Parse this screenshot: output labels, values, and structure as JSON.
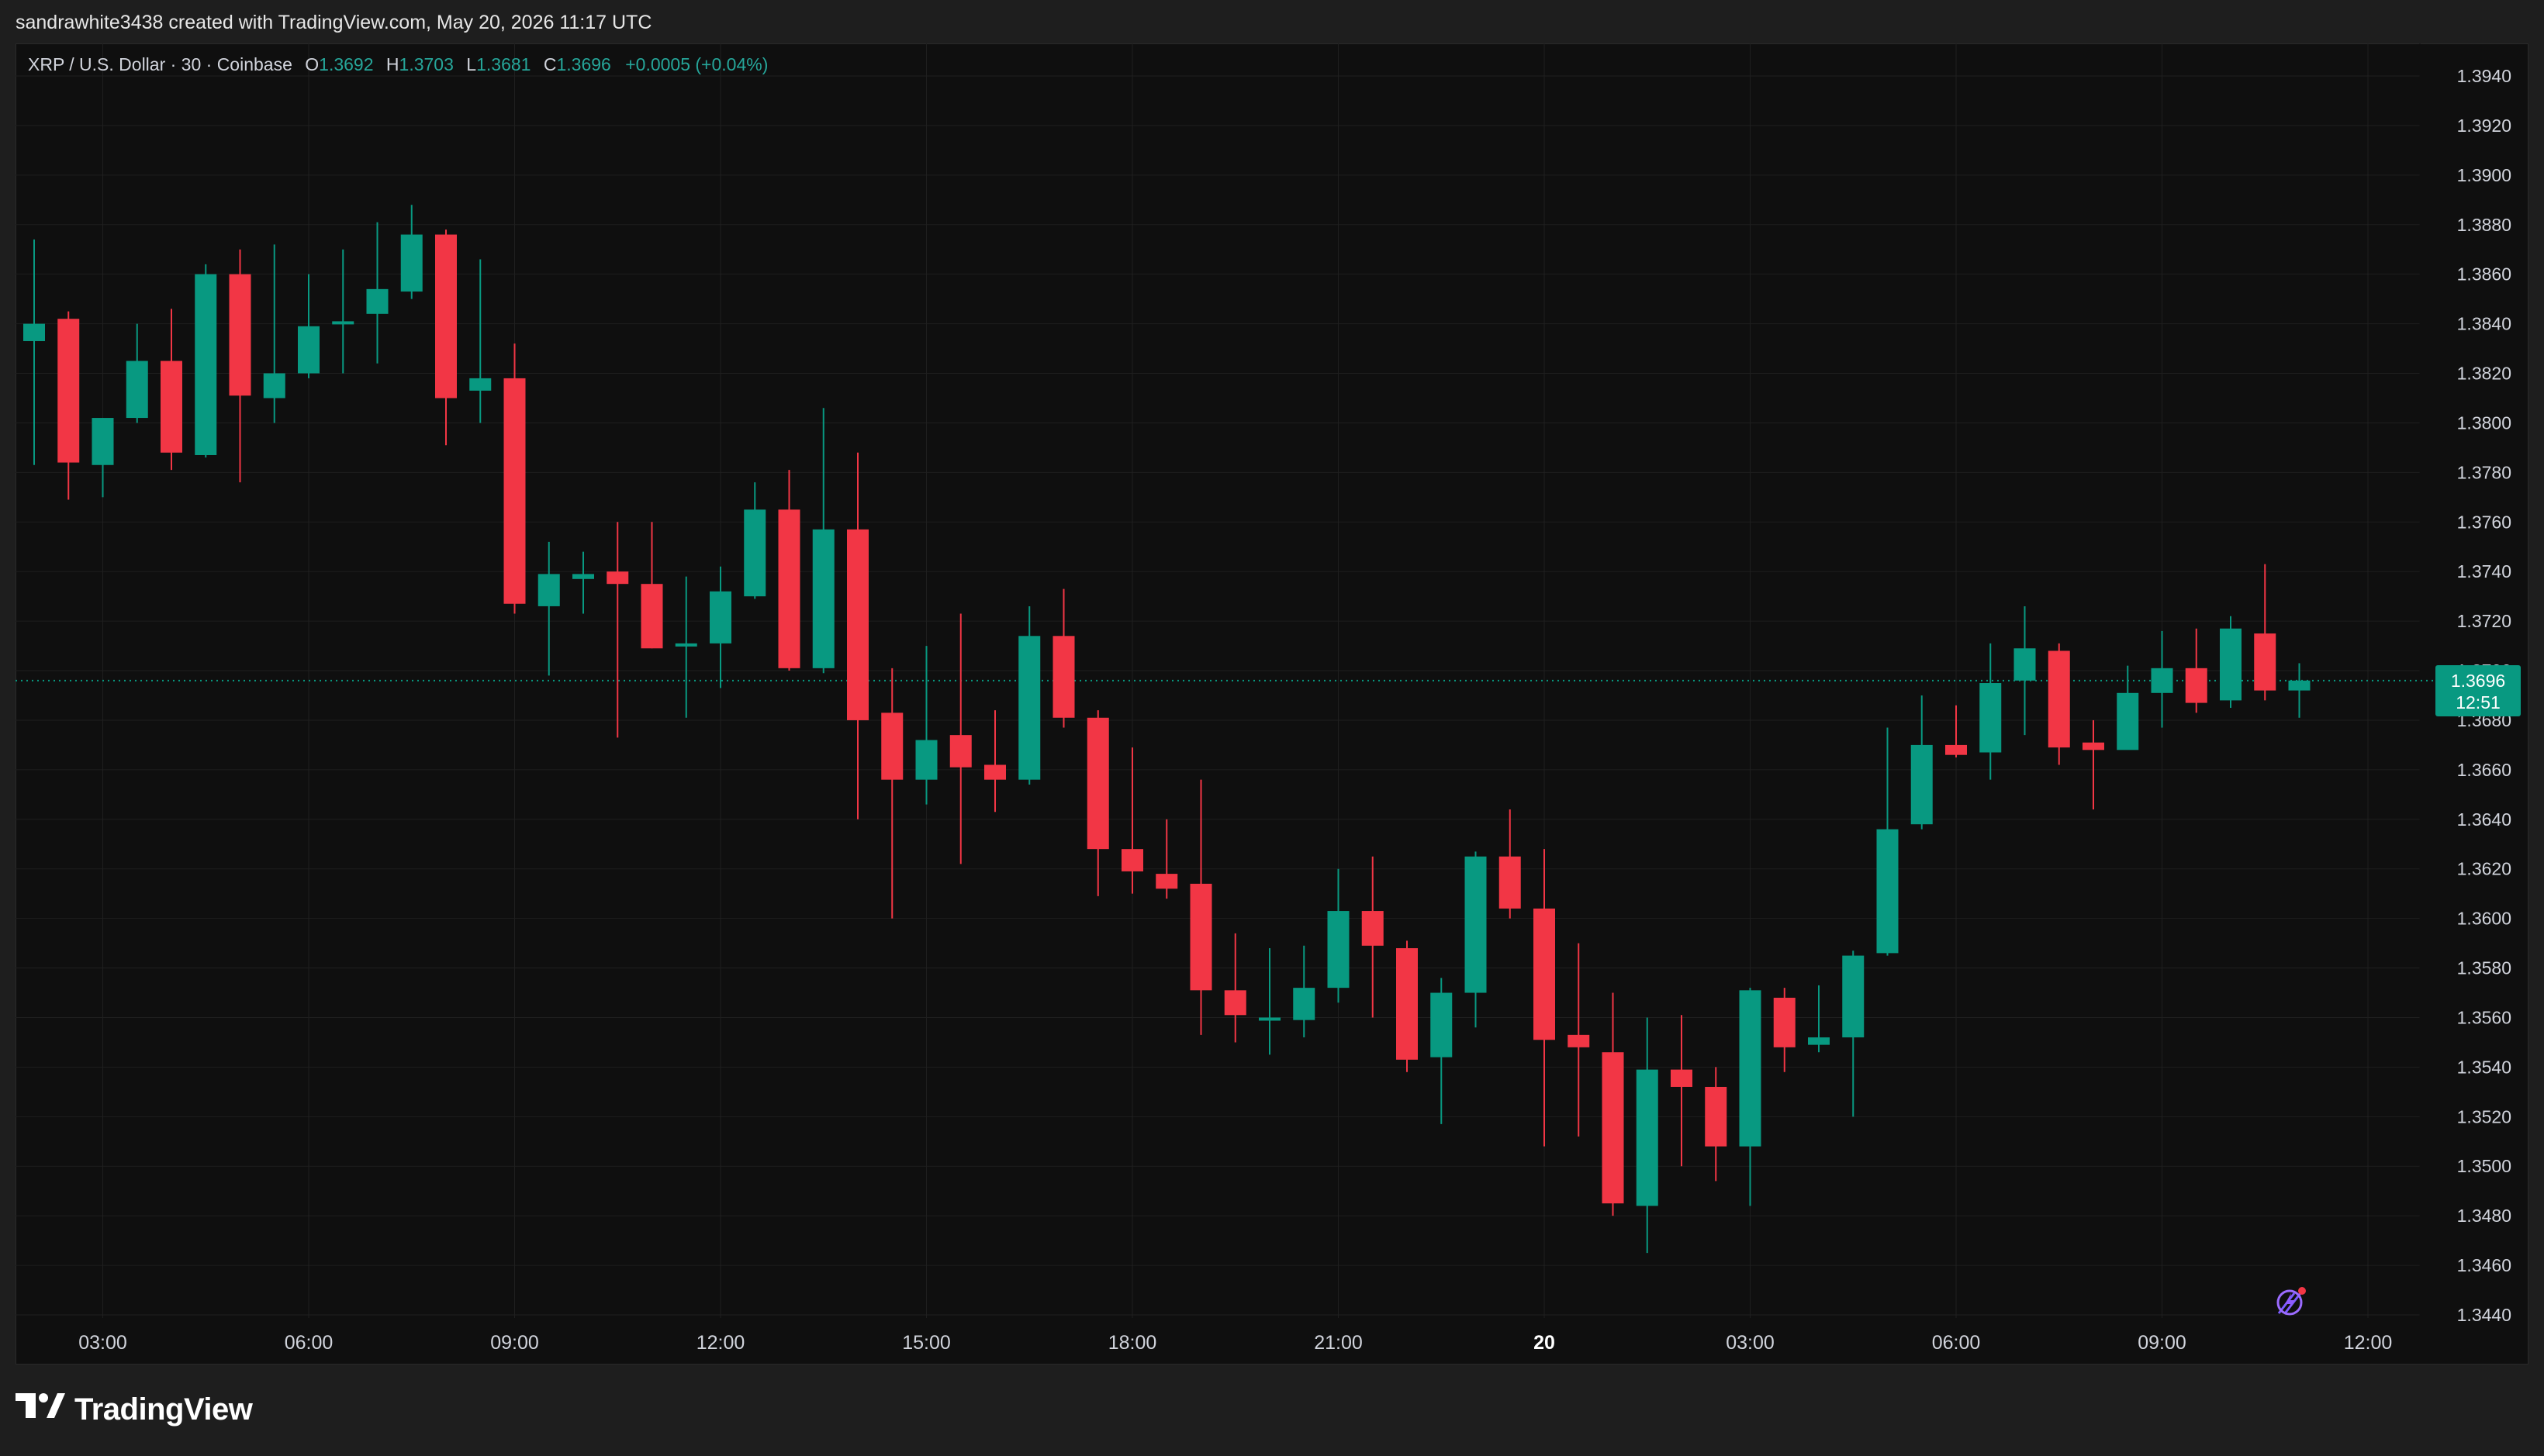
{
  "header": {
    "attribution": "sandrawhite3438 created with TradingView.com, May 20, 2026 11:17 UTC"
  },
  "legend": {
    "symbol": "XRP / U.S. Dollar · 30 · Coinbase",
    "o_label": "O",
    "o_value": "1.3692",
    "h_label": "H",
    "h_value": "1.3703",
    "l_label": "L",
    "l_value": "1.3681",
    "c_label": "C",
    "c_value": "1.3696",
    "change": "+0.0005 (+0.04%)"
  },
  "price_tag": {
    "price": "1.3696",
    "countdown": "12:51"
  },
  "footer": {
    "brand": "TradingView"
  },
  "colors": {
    "up": "#089981",
    "down": "#f23645",
    "background": "#0f0f0f",
    "grid": "#1f1f1f",
    "text": "#d1d4dc"
  },
  "chart_data": {
    "type": "candlestick",
    "ylim": [
      1.344,
      1.394
    ],
    "y_ticks": [
      "1.3940",
      "1.3920",
      "1.3900",
      "1.3880",
      "1.3860",
      "1.3840",
      "1.3820",
      "1.3800",
      "1.3780",
      "1.3760",
      "1.3740",
      "1.3720",
      "1.3700",
      "1.3680",
      "1.3660",
      "1.3640",
      "1.3620",
      "1.3600",
      "1.3580",
      "1.3560",
      "1.3540",
      "1.3520",
      "1.3500",
      "1.3480",
      "1.3460",
      "1.3440"
    ],
    "x_ticks": [
      {
        "label": "03:00",
        "bar": 2,
        "bold": false
      },
      {
        "label": "06:00",
        "bar": 8,
        "bold": false
      },
      {
        "label": "09:00",
        "bar": 14,
        "bold": false
      },
      {
        "label": "12:00",
        "bar": 20,
        "bold": false
      },
      {
        "label": "15:00",
        "bar": 26,
        "bold": false
      },
      {
        "label": "18:00",
        "bar": 32,
        "bold": false
      },
      {
        "label": "21:00",
        "bar": 38,
        "bold": false
      },
      {
        "label": "20",
        "bar": 44,
        "bold": true
      },
      {
        "label": "03:00",
        "bar": 50,
        "bold": false
      },
      {
        "label": "06:00",
        "bar": 56,
        "bold": false
      },
      {
        "label": "09:00",
        "bar": 62,
        "bold": false
      },
      {
        "label": "12:00",
        "bar": 68,
        "bold": false
      }
    ],
    "last_price": 1.3696,
    "candles": [
      {
        "o": 1.3833,
        "h": 1.3874,
        "l": 1.3783,
        "c": 1.384
      },
      {
        "o": 1.3842,
        "h": 1.3845,
        "l": 1.3769,
        "c": 1.3784
      },
      {
        "o": 1.3783,
        "h": 1.3802,
        "l": 1.377,
        "c": 1.3802
      },
      {
        "o": 1.3802,
        "h": 1.384,
        "l": 1.38,
        "c": 1.3825
      },
      {
        "o": 1.3825,
        "h": 1.3846,
        "l": 1.3781,
        "c": 1.3788
      },
      {
        "o": 1.3787,
        "h": 1.3864,
        "l": 1.3786,
        "c": 1.386
      },
      {
        "o": 1.386,
        "h": 1.387,
        "l": 1.3776,
        "c": 1.3811
      },
      {
        "o": 1.381,
        "h": 1.3872,
        "l": 1.38,
        "c": 1.382
      },
      {
        "o": 1.382,
        "h": 1.386,
        "l": 1.3818,
        "c": 1.3839
      },
      {
        "o": 1.384,
        "h": 1.387,
        "l": 1.382,
        "c": 1.3841
      },
      {
        "o": 1.3844,
        "h": 1.3881,
        "l": 1.3824,
        "c": 1.3854
      },
      {
        "o": 1.3853,
        "h": 1.3888,
        "l": 1.385,
        "c": 1.3876
      },
      {
        "o": 1.3876,
        "h": 1.3878,
        "l": 1.3791,
        "c": 1.381
      },
      {
        "o": 1.3813,
        "h": 1.3866,
        "l": 1.38,
        "c": 1.3818
      },
      {
        "o": 1.3818,
        "h": 1.3832,
        "l": 1.3723,
        "c": 1.3727
      },
      {
        "o": 1.3726,
        "h": 1.3752,
        "l": 1.3698,
        "c": 1.3739
      },
      {
        "o": 1.3737,
        "h": 1.3748,
        "l": 1.3723,
        "c": 1.3739
      },
      {
        "o": 1.374,
        "h": 1.376,
        "l": 1.3673,
        "c": 1.3735
      },
      {
        "o": 1.3735,
        "h": 1.376,
        "l": 1.3709,
        "c": 1.3709
      },
      {
        "o": 1.371,
        "h": 1.3738,
        "l": 1.3681,
        "c": 1.3711
      },
      {
        "o": 1.3711,
        "h": 1.3742,
        "l": 1.3693,
        "c": 1.3732
      },
      {
        "o": 1.373,
        "h": 1.3776,
        "l": 1.3729,
        "c": 1.3765
      },
      {
        "o": 1.3765,
        "h": 1.3781,
        "l": 1.37,
        "c": 1.3701
      },
      {
        "o": 1.3701,
        "h": 1.3806,
        "l": 1.3699,
        "c": 1.3757
      },
      {
        "o": 1.3757,
        "h": 1.3788,
        "l": 1.364,
        "c": 1.368
      },
      {
        "o": 1.3683,
        "h": 1.3701,
        "l": 1.36,
        "c": 1.3656
      },
      {
        "o": 1.3656,
        "h": 1.371,
        "l": 1.3646,
        "c": 1.3672
      },
      {
        "o": 1.3674,
        "h": 1.3723,
        "l": 1.3622,
        "c": 1.3661
      },
      {
        "o": 1.3662,
        "h": 1.3684,
        "l": 1.3643,
        "c": 1.3656
      },
      {
        "o": 1.3656,
        "h": 1.3726,
        "l": 1.3654,
        "c": 1.3714
      },
      {
        "o": 1.3714,
        "h": 1.3733,
        "l": 1.3677,
        "c": 1.3681
      },
      {
        "o": 1.3681,
        "h": 1.3684,
        "l": 1.3609,
        "c": 1.3628
      },
      {
        "o": 1.3628,
        "h": 1.3669,
        "l": 1.361,
        "c": 1.3619
      },
      {
        "o": 1.3618,
        "h": 1.364,
        "l": 1.3608,
        "c": 1.3612
      },
      {
        "o": 1.3614,
        "h": 1.3656,
        "l": 1.3553,
        "c": 1.3571
      },
      {
        "o": 1.3571,
        "h": 1.3594,
        "l": 1.355,
        "c": 1.3561
      },
      {
        "o": 1.3559,
        "h": 1.3588,
        "l": 1.3545,
        "c": 1.356
      },
      {
        "o": 1.3559,
        "h": 1.3589,
        "l": 1.3552,
        "c": 1.3572
      },
      {
        "o": 1.3572,
        "h": 1.362,
        "l": 1.3566,
        "c": 1.3603
      },
      {
        "o": 1.3603,
        "h": 1.3625,
        "l": 1.356,
        "c": 1.3589
      },
      {
        "o": 1.3588,
        "h": 1.3591,
        "l": 1.3538,
        "c": 1.3543
      },
      {
        "o": 1.3544,
        "h": 1.3576,
        "l": 1.3517,
        "c": 1.357
      },
      {
        "o": 1.357,
        "h": 1.3627,
        "l": 1.3556,
        "c": 1.3625
      },
      {
        "o": 1.3625,
        "h": 1.3644,
        "l": 1.36,
        "c": 1.3604
      },
      {
        "o": 1.3604,
        "h": 1.3628,
        "l": 1.3508,
        "c": 1.3551
      },
      {
        "o": 1.3553,
        "h": 1.359,
        "l": 1.3512,
        "c": 1.3548
      },
      {
        "o": 1.3546,
        "h": 1.357,
        "l": 1.348,
        "c": 1.3485
      },
      {
        "o": 1.3484,
        "h": 1.356,
        "l": 1.3465,
        "c": 1.3539
      },
      {
        "o": 1.3539,
        "h": 1.3561,
        "l": 1.35,
        "c": 1.3532
      },
      {
        "o": 1.3532,
        "h": 1.354,
        "l": 1.3494,
        "c": 1.3508
      },
      {
        "o": 1.3508,
        "h": 1.3572,
        "l": 1.3484,
        "c": 1.3571
      },
      {
        "o": 1.3568,
        "h": 1.3572,
        "l": 1.3538,
        "c": 1.3548
      },
      {
        "o": 1.3549,
        "h": 1.3573,
        "l": 1.3546,
        "c": 1.3552
      },
      {
        "o": 1.3552,
        "h": 1.3587,
        "l": 1.352,
        "c": 1.3585
      },
      {
        "o": 1.3586,
        "h": 1.3677,
        "l": 1.3585,
        "c": 1.3636
      },
      {
        "o": 1.3638,
        "h": 1.369,
        "l": 1.3636,
        "c": 1.367
      },
      {
        "o": 1.367,
        "h": 1.3686,
        "l": 1.3665,
        "c": 1.3666
      },
      {
        "o": 1.3667,
        "h": 1.3711,
        "l": 1.3656,
        "c": 1.3695
      },
      {
        "o": 1.3696,
        "h": 1.3726,
        "l": 1.3674,
        "c": 1.3709
      },
      {
        "o": 1.3708,
        "h": 1.3711,
        "l": 1.3662,
        "c": 1.3669
      },
      {
        "o": 1.3671,
        "h": 1.368,
        "l": 1.3644,
        "c": 1.3668
      },
      {
        "o": 1.3668,
        "h": 1.3702,
        "l": 1.3671,
        "c": 1.3691
      },
      {
        "o": 1.3691,
        "h": 1.3716,
        "l": 1.3677,
        "c": 1.3701
      },
      {
        "o": 1.3701,
        "h": 1.3717,
        "l": 1.3683,
        "c": 1.3687
      },
      {
        "o": 1.3688,
        "h": 1.3722,
        "l": 1.3685,
        "c": 1.3717
      },
      {
        "o": 1.3715,
        "h": 1.3743,
        "l": 1.3688,
        "c": 1.3692
      },
      {
        "o": 1.3692,
        "h": 1.3703,
        "l": 1.3681,
        "c": 1.3696
      }
    ]
  }
}
